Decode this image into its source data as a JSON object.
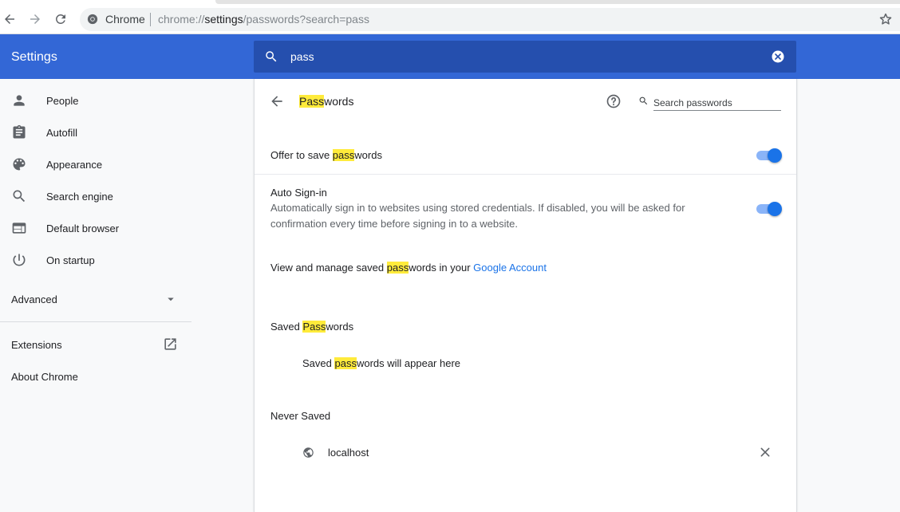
{
  "browser": {
    "omnibox_chip": "Chrome",
    "url_prefix": "chrome://",
    "url_host": "settings",
    "url_path": "/passwords?search=pass"
  },
  "header": {
    "title": "Settings",
    "search_query": "pass"
  },
  "sidebar": {
    "items": [
      {
        "label": "People",
        "icon": "person-icon"
      },
      {
        "label": "Autofill",
        "icon": "clipboard-icon"
      },
      {
        "label": "Appearance",
        "icon": "palette-icon"
      },
      {
        "label": "Search engine",
        "icon": "search-icon"
      },
      {
        "label": "Default browser",
        "icon": "browser-window-icon"
      },
      {
        "label": "On startup",
        "icon": "power-icon"
      }
    ],
    "advanced_label": "Advanced",
    "extensions_label": "Extensions",
    "about_label": "About Chrome"
  },
  "passwords": {
    "title_hl": "Pass",
    "title_rest": "words",
    "search_placeholder": "Search passwords",
    "offer_pre": "Offer to save ",
    "offer_hl": "pass",
    "offer_post": "words",
    "offer_enabled": true,
    "auto_signin_label": "Auto Sign-in",
    "auto_signin_desc": "Automatically sign in to websites using stored credentials. If disabled, you will be asked for confirmation every time before signing in to a website.",
    "auto_signin_enabled": true,
    "manage_pre": "View and manage saved ",
    "manage_hl": "pass",
    "manage_mid": "words in your ",
    "manage_link": "Google Account",
    "saved_pre": "Saved ",
    "saved_hl": "Pass",
    "saved_post": "words",
    "empty_pre": "Saved ",
    "empty_hl": "pass",
    "empty_post": "words will appear here",
    "never_saved_title": "Never Saved",
    "never_saved_sites": [
      "localhost"
    ]
  },
  "colors": {
    "header_blue": "#3367d6",
    "search_box": "#254fae",
    "highlight": "#ffeb3b",
    "toggle_on": "#1a73e8",
    "link": "#1a73e8"
  }
}
